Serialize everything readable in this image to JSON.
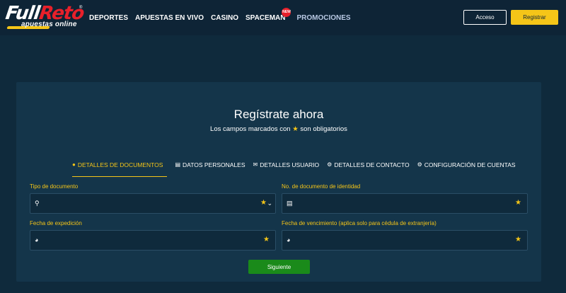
{
  "brand": {
    "logo_main_a": "Full",
    "logo_main_b": "Reto",
    "logo_sub": "apuestas online",
    "reg_mark": "®"
  },
  "nav": {
    "items": [
      {
        "label": "DEPORTES"
      },
      {
        "label": "APUESTAS EN VIVO"
      },
      {
        "label": "CASINO"
      },
      {
        "label": "SPACEMAN",
        "badge": "NEW"
      },
      {
        "label": "PROMOCIONES"
      }
    ]
  },
  "header": {
    "login_label": "Acceso",
    "register_label": "Registrar"
  },
  "form": {
    "title": "Regístrate ahora",
    "subtitle_a": "Los campos marcados con",
    "subtitle_star": "★",
    "subtitle_b": "son obligatorios",
    "tabs": [
      {
        "label": "DETALLES DE DOCUMENTOS",
        "icon": "user-icon",
        "glyph": "👤"
      },
      {
        "label": "DATOS PERSONALES",
        "icon": "id-card-icon",
        "glyph": "▤"
      },
      {
        "label": "DETALLES USUARIO",
        "icon": "envelope-icon",
        "glyph": "✉"
      },
      {
        "label": "DETALLES DE CONTACTO",
        "icon": "gear-icon",
        "glyph": "⚙"
      },
      {
        "label": "CONFIGURACIÓN DE CUENTAS",
        "icon": "gear-icon",
        "glyph": "⚙"
      }
    ],
    "fields": {
      "doc_type_label": "Tipo de documento",
      "doc_number_label": "No. de documento de identidad",
      "issue_date_label": "Fecha de expedición",
      "expiry_date_label": "Fecha de vencimiento (aplica solo para cédula de extranjería)"
    },
    "required_star": "★",
    "chevron": "⌄",
    "next_label": "Siguiente"
  },
  "colors": {
    "accent": "#f5c518",
    "brand_red": "#e8202a",
    "next_green": "#1a8a1a",
    "background": "#0f2a3c",
    "card": "#14354a"
  }
}
